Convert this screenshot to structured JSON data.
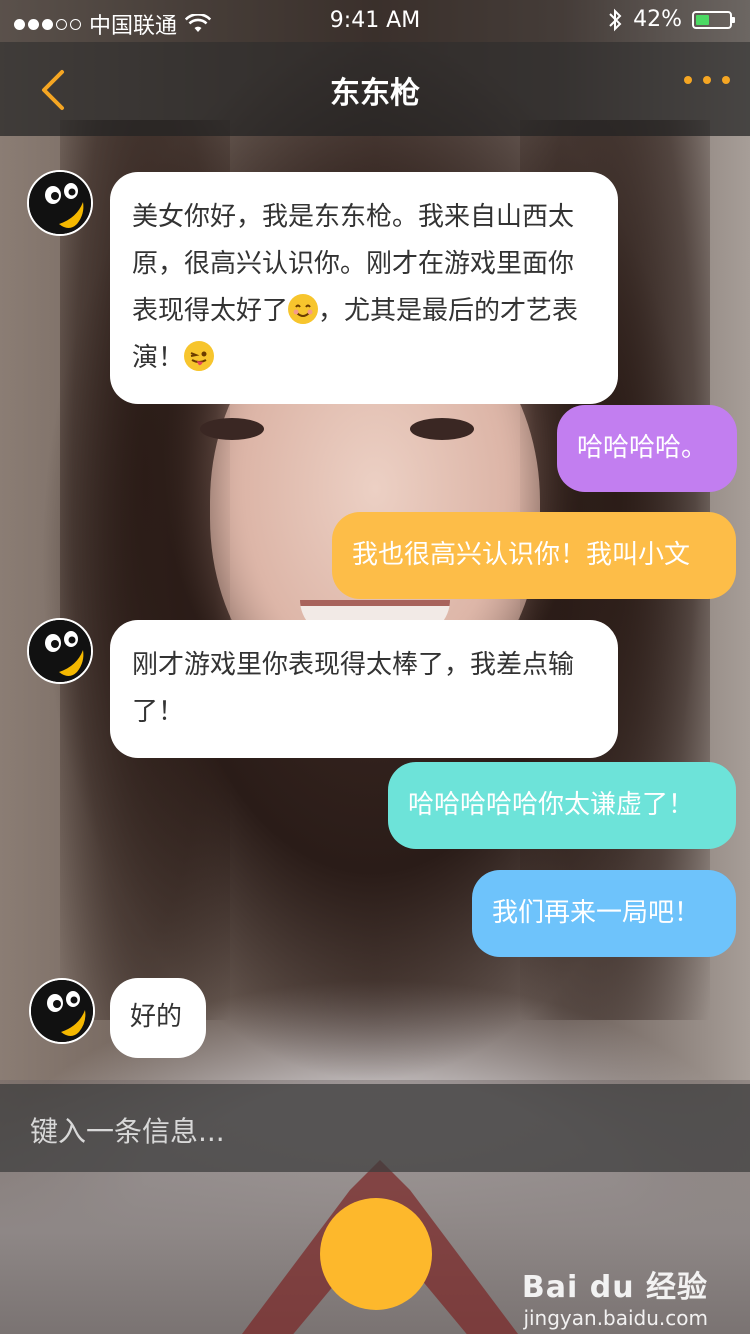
{
  "status_bar": {
    "carrier": "中国联通",
    "time": "9:41 AM",
    "battery": "42%",
    "battery_level": 0.42
  },
  "nav": {
    "title": "东东枪"
  },
  "messages": [
    {
      "side": "in",
      "text": "美女你好，我是东东枪。我来自山西太原，很高兴认识你。刚才在游戏里面你表现得太好了",
      "text_after": "，尤其是最后的才艺表演！",
      "emojis": [
        "smiling-face",
        "winking-tongue-face"
      ]
    },
    {
      "side": "out",
      "text": "哈哈哈哈。",
      "color": "#c27ef0"
    },
    {
      "side": "out",
      "text": "我也很高兴认识你！我叫小文",
      "color": "#fdbd48"
    },
    {
      "side": "in",
      "text": "刚才游戏里你表现得太棒了，我差点输了！"
    },
    {
      "side": "out",
      "text": "哈哈哈哈哈你太谦虚了！",
      "color": "#6de3d9"
    },
    {
      "side": "out",
      "text": "我们再来一局吧！",
      "color": "#6ec3fb"
    },
    {
      "side": "in",
      "text": "好的"
    }
  ],
  "input": {
    "placeholder": "键入一条信息..."
  },
  "watermark": {
    "brand": "Bai du 经验",
    "url": "jingyan.baidu.com"
  },
  "colors": {
    "accent": "#f5a623",
    "send_button": "#fdb82c"
  }
}
